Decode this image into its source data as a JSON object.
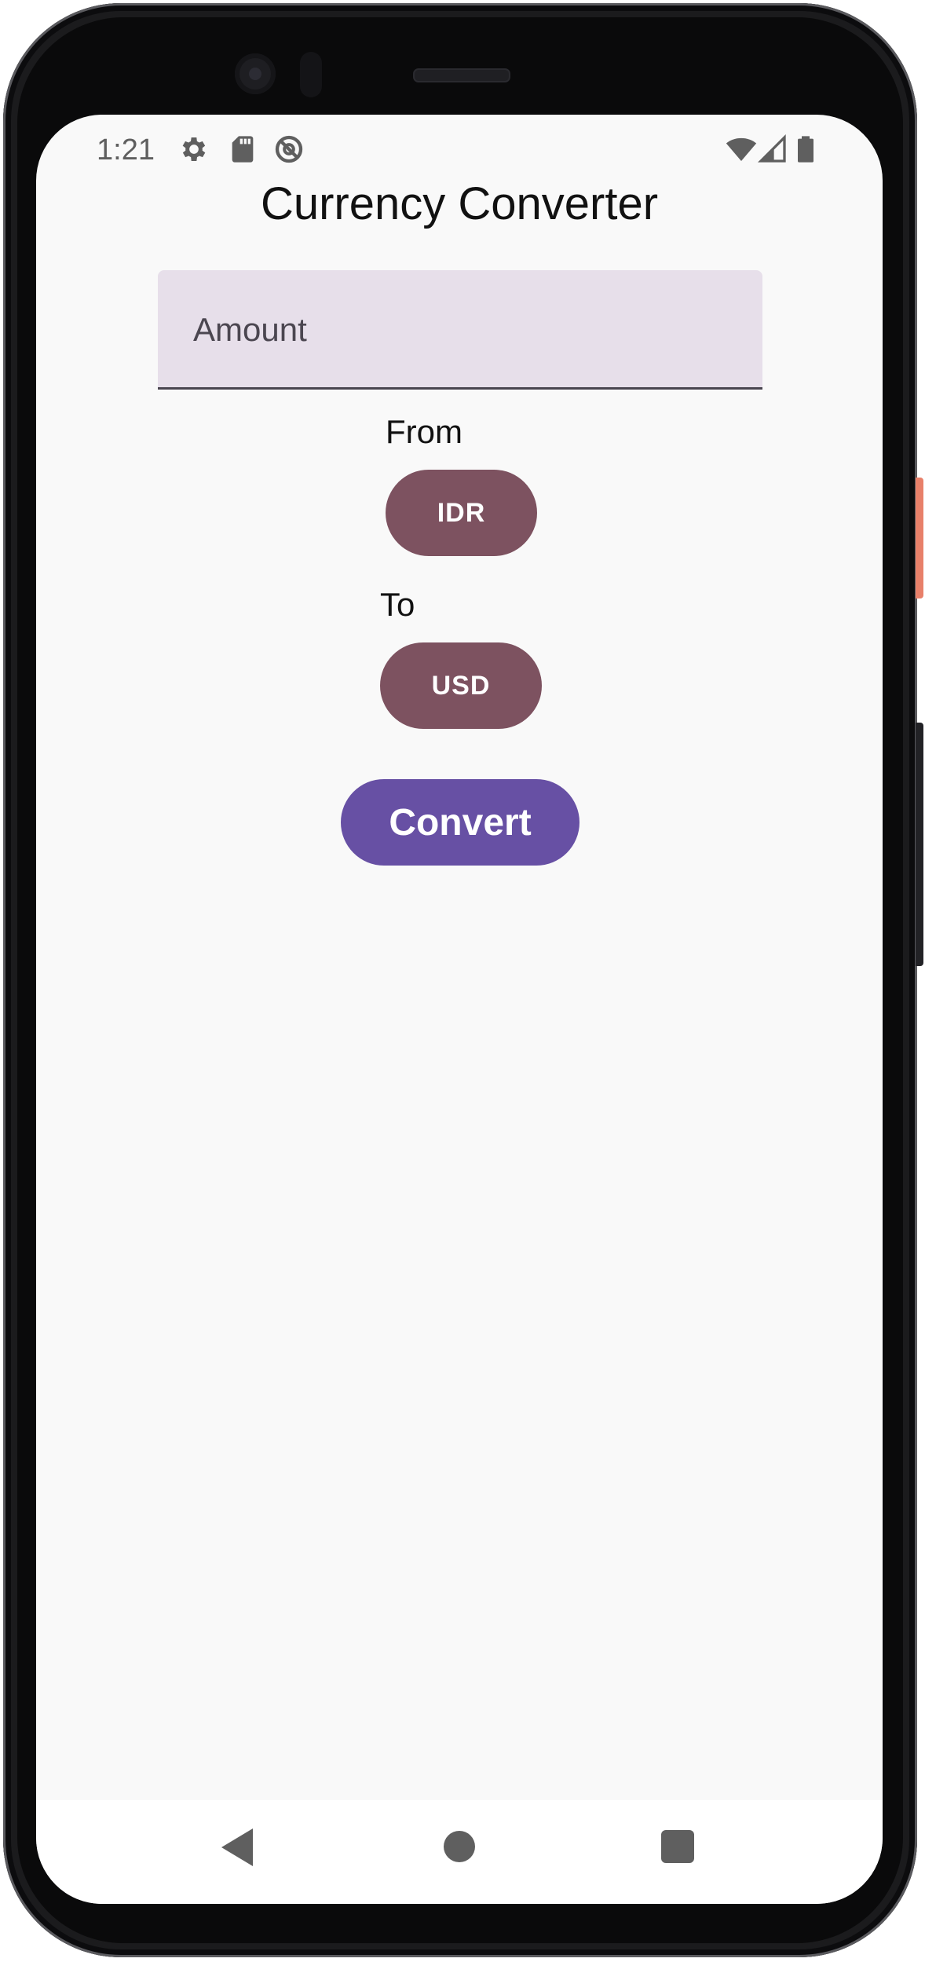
{
  "status_bar": {
    "time": "1:21",
    "left_icons": [
      "gear-icon",
      "sd-card-icon",
      "no-sync-icon"
    ],
    "right_icons": [
      "wifi-icon",
      "cell-signal-icon",
      "battery-icon"
    ]
  },
  "app": {
    "title": "Currency Converter",
    "amount_placeholder": "Amount",
    "from_label": "From",
    "from_currency": "IDR",
    "to_label": "To",
    "to_currency": "USD",
    "convert_label": "Convert"
  },
  "nav_bar": {
    "icons": [
      "back-icon",
      "home-icon",
      "recent-apps-icon"
    ]
  },
  "colors": {
    "field_background": "#e7dfea",
    "currency_pill": "#7d5260",
    "convert_button": "#6750a4",
    "screen_background": "#f9f9f9"
  }
}
